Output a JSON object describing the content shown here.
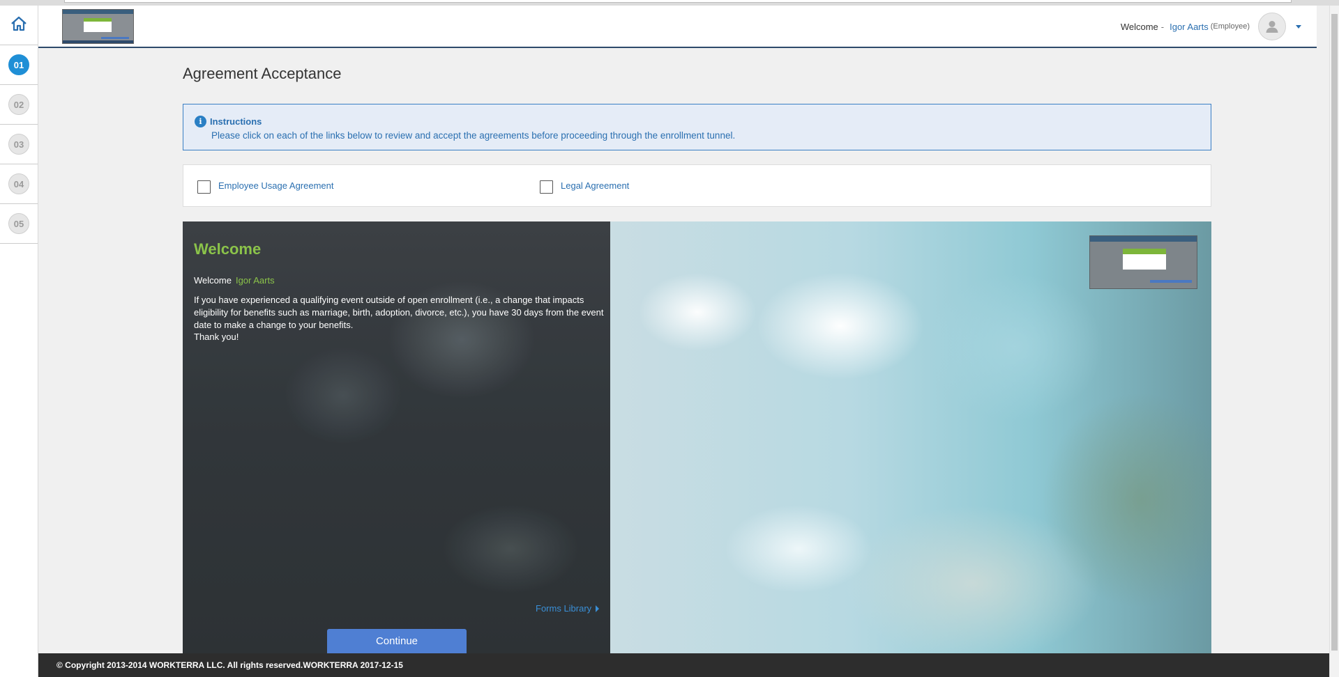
{
  "header": {
    "welcome_label": "Welcome",
    "user_name": "Igor Aarts",
    "user_role": "(Employee)",
    "icons": [
      "home-icon",
      "user-avatar-icon",
      "caret-down-icon"
    ]
  },
  "sidebar": {
    "steps": [
      "01",
      "02",
      "03",
      "04",
      "05"
    ],
    "active_step": "01"
  },
  "page": {
    "title": "Agreement Acceptance"
  },
  "instructions": {
    "title": "Instructions",
    "text": "Please click on each of the links below to review and accept the agreements before proceeding through the enrollment tunnel."
  },
  "agreements": [
    {
      "label": "Employee Usage Agreement",
      "checked": false
    },
    {
      "label": "Legal Agreement",
      "checked": false
    }
  ],
  "hero": {
    "title": "Welcome",
    "welcome_label": "Welcome",
    "user_name": "Igor Aarts",
    "body": "If you have experienced a qualifying event outside of open enrollment (i.e., a change that impacts eligibility for benefits such as marriage, birth, adoption, divorce, etc.), you have 30 days from the event date to make a change to your benefits.",
    "thanks": "Thank you!",
    "forms_link": "Forms Library",
    "continue_label": "Continue"
  },
  "footer": {
    "text": "© Copyright 2013-2014 WORKTERRA LLC. All rights reserved.WORKTERRA 2017-12-15"
  },
  "colors": {
    "accent_blue": "#1f8fd6",
    "link_blue": "#2a6fb0",
    "brand_green": "#8bc34a",
    "button_blue": "#4f7fd3",
    "footer_bg": "#2d2d2d"
  }
}
